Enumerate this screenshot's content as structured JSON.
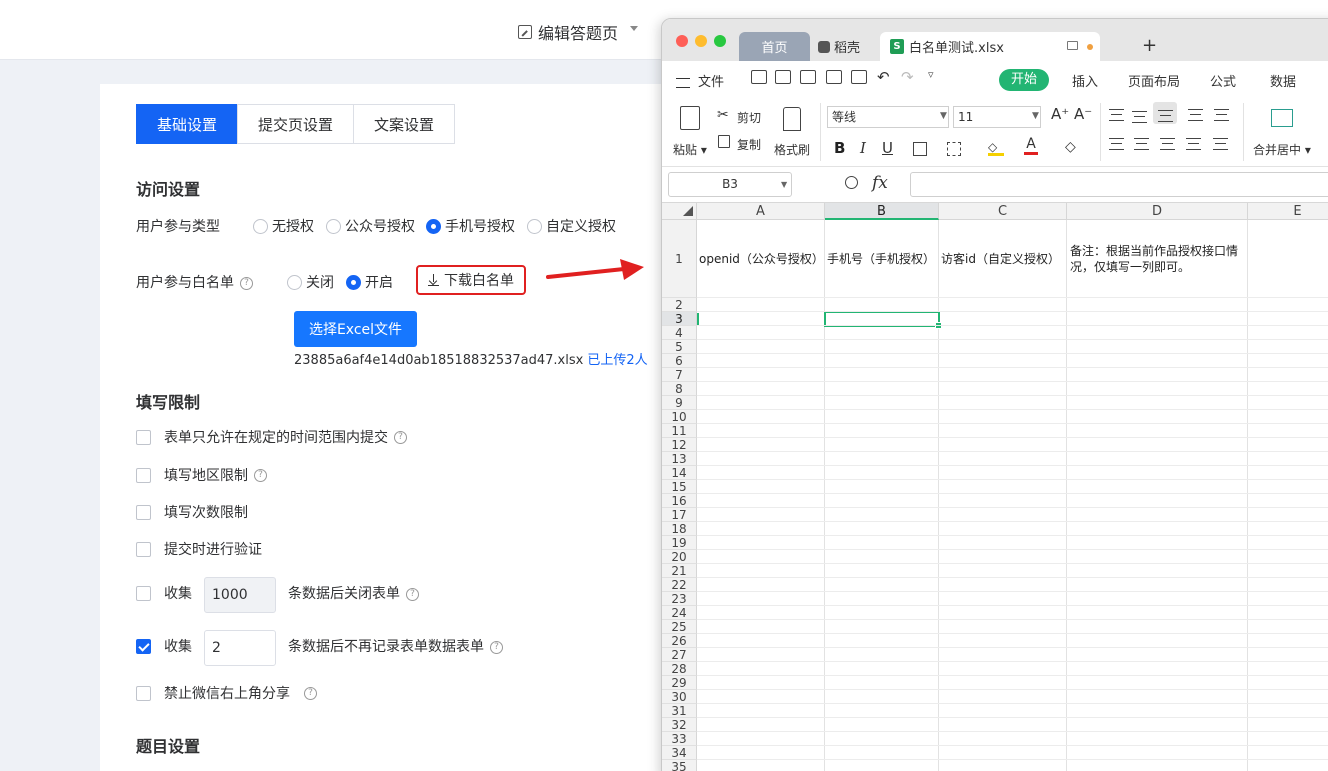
{
  "header": {
    "edit_label": "编辑答题页"
  },
  "tabs": [
    {
      "label": "基础设置",
      "active": true
    },
    {
      "label": "提交页设置",
      "active": false
    },
    {
      "label": "文案设置",
      "active": false
    }
  ],
  "access": {
    "title": "访问设置",
    "user_type_label": "用户参与类型",
    "user_type_options": [
      "无授权",
      "公众号授权",
      "手机号授权",
      "自定义授权"
    ],
    "user_type_selected": "手机号授权",
    "whitelist_label": "用户参与白名单",
    "whitelist_options": [
      "关闭",
      "开启"
    ],
    "whitelist_selected": "开启",
    "download_label": "下载白名单",
    "select_excel_label": "选择Excel文件",
    "uploaded_file": "23885a6af4e14d0ab18518832537ad47.xlsx",
    "uploaded_status": "已上传2人"
  },
  "limits": {
    "title": "填写限制",
    "items": [
      {
        "label": "表单只允许在规定的时间范围内提交",
        "checked": false,
        "help": true
      },
      {
        "label": "填写地区限制",
        "checked": false,
        "help": true
      },
      {
        "label": "填写次数限制",
        "checked": false,
        "help": false
      },
      {
        "label": "提交时进行验证",
        "checked": false,
        "help": false
      }
    ],
    "collect1": {
      "prefix": "收集",
      "value": "1000",
      "suffix": "条数据后关闭表单",
      "checked": false
    },
    "collect2": {
      "prefix": "收集",
      "value": "2",
      "suffix": "条数据后不再记录表单数据表单",
      "checked": true
    },
    "share": {
      "label": "禁止微信右上角分享",
      "checked": false
    }
  },
  "questions": {
    "title": "题目设置"
  },
  "help_glyph": "?",
  "spreadsheet": {
    "tabs": {
      "home": "首页",
      "daoke": "稻壳",
      "file": "白名单测试.xlsx"
    },
    "new_tab": "+",
    "menu": {
      "file": "文件",
      "start": "开始",
      "insert": "插入",
      "layout": "页面布局",
      "formula": "公式",
      "data": "数据"
    },
    "ribbon": {
      "paste": "粘贴",
      "cut": "剪切",
      "copy": "复制",
      "format_painter": "格式刷",
      "font_name": "等线",
      "font_size": "11",
      "merge": "合并居中"
    },
    "name_box": "B3",
    "fx": "fx",
    "columns": [
      "A",
      "B",
      "C",
      "D",
      "E"
    ],
    "selected_column": "B",
    "selected_row": 3,
    "cells": {
      "A1": "openid（公众号授权）",
      "B1": "手机号（手机授权）",
      "C1": "访客id（自定义授权）",
      "D1": "备注：根据当前作品授权接口情况，仅填写一列即可。"
    },
    "row_count": 35
  },
  "colors": {
    "primary": "#1464f4",
    "highlight_border": "#e02020",
    "sheet_accent": "#22b573"
  }
}
